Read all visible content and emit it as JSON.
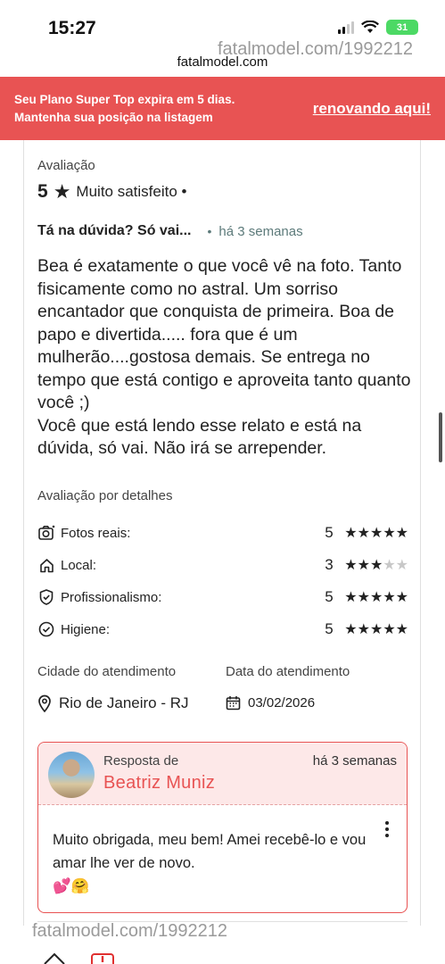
{
  "status_bar": {
    "time": "15:27",
    "battery": "31"
  },
  "watermark": {
    "top": "fatalmodel.com/1992212",
    "bottom": "fatalmodel.com/1992212"
  },
  "domain": "fatalmodel.com",
  "banner": {
    "line1": "Seu Plano Super Top expira em 5 dias.",
    "line2": "Mantenha sua posição na listagem",
    "link": "renovando aqui!",
    "color": "#e85353"
  },
  "review": {
    "rating_label": "Avaliação",
    "rating_value": "5",
    "rating_text": "Muito satisfeito •",
    "title": "Tá na dúvida? Só vai...",
    "dot": "•",
    "when": "há 3 semanas",
    "body": "Bea é exatamente o que você vê na foto. Tanto fisicamente como no astral. Um sorriso encantador que conquista de primeira. Boa de papo e divertida..... fora que é um mulherão....gostosa demais. Se entrega no tempo que está contigo e aproveita tanto quanto você ;)\nVocê que está lendo esse relato e está na dúvida, só vai. Não irá se arrepender."
  },
  "details": {
    "title": "Avaliação por detalhes",
    "items": [
      {
        "label": "Fotos reais:",
        "score": "5",
        "stars": 5,
        "icon": "camera-icon"
      },
      {
        "label": "Local:",
        "score": "3",
        "stars": 3,
        "icon": "home-icon"
      },
      {
        "label": "Profissionalismo:",
        "score": "5",
        "stars": 5,
        "icon": "badge-check-icon"
      },
      {
        "label": "Higiene:",
        "score": "5",
        "stars": 5,
        "icon": "check-circle-icon"
      }
    ]
  },
  "service": {
    "city_label": "Cidade do atendimento",
    "city": "Rio de Janeiro - RJ",
    "date_label": "Data do atendimento",
    "date": "03/02/2026"
  },
  "reply": {
    "from_label": "Resposta de",
    "name": "Beatriz Muniz",
    "when": "há 3 semanas",
    "body": "Muito obrigada, meu bem! Amei recebê-lo e vou amar lhe ver de novo.",
    "emoji": "💕🤗"
  }
}
